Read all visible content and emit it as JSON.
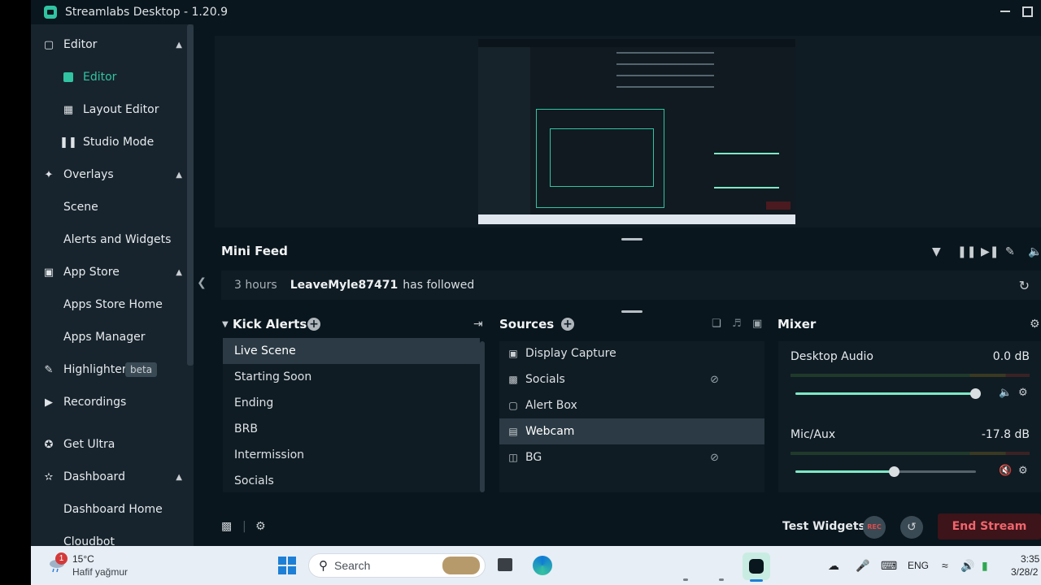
{
  "app": {
    "title": "Streamlabs Desktop - 1.20.9"
  },
  "sidebar": {
    "items": [
      {
        "label": "Editor",
        "icon": "editor-icon",
        "expanded": true
      },
      {
        "label": "Editor",
        "icon": "editor-icon",
        "active": true
      },
      {
        "label": "Layout Editor",
        "icon": "layout-icon"
      },
      {
        "label": "Studio Mode",
        "icon": "studio-mode-icon"
      },
      {
        "label": "Overlays",
        "icon": "overlays-icon",
        "expanded": true
      },
      {
        "label": "Scene"
      },
      {
        "label": "Alerts and Widgets"
      },
      {
        "label": "App Store",
        "icon": "app-store-icon",
        "expanded": true
      },
      {
        "label": "Apps Store Home"
      },
      {
        "label": "Apps Manager"
      },
      {
        "label": "Highlighter",
        "icon": "highlighter-icon",
        "badge": "beta"
      },
      {
        "label": "Recordings",
        "icon": "recordings-icon"
      },
      {
        "label": "Get Ultra",
        "icon": "ultra-icon"
      },
      {
        "label": "Dashboard",
        "icon": "dashboard-icon",
        "expanded": true
      },
      {
        "label": "Dashboard Home"
      },
      {
        "label": "Cloudbot"
      }
    ]
  },
  "mini_feed": {
    "title": "Mini Feed",
    "event": {
      "time": "3 hours",
      "user": "LeaveMyle87471",
      "action": "has followed"
    }
  },
  "scenes": {
    "title": "Kick Alerts",
    "items": [
      "Live Scene",
      "Starting Soon",
      "Ending",
      "BRB",
      "Intermission",
      "Socials"
    ],
    "active_index": 0
  },
  "sources": {
    "title": "Sources",
    "items": [
      {
        "label": "Display Capture",
        "icon": "monitor-icon",
        "hidden": false
      },
      {
        "label": "Socials",
        "icon": "scene-icon",
        "hidden": true
      },
      {
        "label": "Alert Box",
        "icon": "widget-icon",
        "hidden": false
      },
      {
        "label": "Webcam",
        "icon": "folder-icon",
        "hidden": false,
        "active": true
      },
      {
        "label": "BG",
        "icon": "file-icon",
        "hidden": true
      }
    ]
  },
  "mixer": {
    "title": "Mixer",
    "channels": [
      {
        "name": "Desktop Audio",
        "db": "0.0 dB",
        "level": 1.0,
        "muted": false
      },
      {
        "name": "Mic/Aux",
        "db": "-17.8 dB",
        "level": 0.55,
        "muted": true
      }
    ]
  },
  "footer": {
    "test_widgets": "Test Widgets",
    "rec_label": "REC",
    "end_stream": "End Stream"
  },
  "taskbar": {
    "weather": {
      "badge": "1",
      "temp": "15°C",
      "desc": "Hafif yağmur"
    },
    "search_placeholder": "Search",
    "language": "ENG",
    "time": "3:35",
    "date": "3/28/2"
  },
  "colors": {
    "accent": "#31c3a2",
    "end_stream": "#f0656d",
    "background": "#09161d",
    "panel": "#0f1c24"
  }
}
